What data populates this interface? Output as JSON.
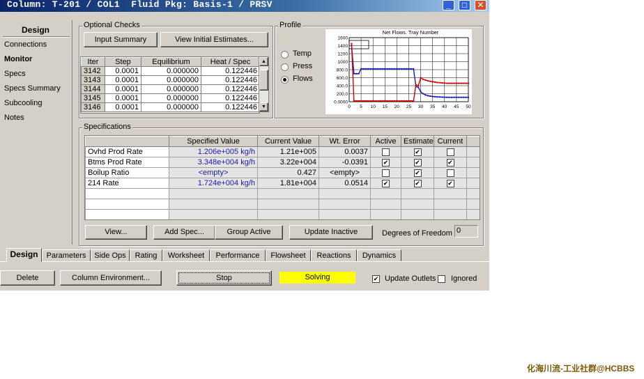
{
  "window": {
    "title": "Column: T-201 / COL1  Fluid Pkg: Basis-1 / PRSV",
    "controls": {
      "minimize": "_",
      "maximize": "□",
      "close": "✕"
    }
  },
  "nav": {
    "heading": "Design",
    "items": [
      "Connections",
      "Monitor",
      "Specs",
      "Specs Summary",
      "Subcooling",
      "Notes"
    ],
    "selected": "Monitor"
  },
  "optional_checks": {
    "label": "Optional Checks",
    "input_summary": "Input Summary",
    "view_initial": "View Initial Estimates..."
  },
  "iterations": {
    "columns": [
      "Iter",
      "Step",
      "Equilibrium",
      "Heat / Spec"
    ],
    "rows": [
      [
        "314­2",
        "0.0001",
        "0.000000",
        "0.122446"
      ],
      [
        "314­3",
        "0.0001",
        "0.000000",
        "0.122446"
      ],
      [
        "314­4",
        "0.0001",
        "0.000000",
        "0.122446"
      ],
      [
        "314­5",
        "0.0001",
        "0.000000",
        "0.122446"
      ],
      [
        "314­6",
        "0.0001",
        "0.000000",
        "0.122446"
      ]
    ],
    "row_labels": [
      "3142",
      "3143",
      "3144",
      "3145",
      "3146"
    ]
  },
  "profile": {
    "label": "Profile",
    "options": [
      "Temp",
      "Press",
      "Flows"
    ],
    "selected": "Flows"
  },
  "chart_data": {
    "type": "line",
    "title": "Net Flows. Tray Number",
    "x_ticks": [
      "0",
      "5",
      "10",
      "15",
      "20",
      "25",
      "30",
      "35",
      "40",
      "45",
      "50"
    ],
    "y_ticks": [
      "0.0000",
      "200.0",
      "400.0",
      "600.0",
      "800.0",
      "1000",
      "1200",
      "1400",
      "1600"
    ],
    "xlim": [
      0,
      50
    ],
    "ylim": [
      0,
      1600
    ],
    "series": [
      {
        "color": "#1a1ab4",
        "x": [
          1,
          2,
          3,
          4,
          5,
          6,
          7,
          8,
          9,
          10,
          11,
          12,
          13,
          14,
          15,
          16,
          17,
          18,
          19,
          20,
          21,
          22,
          23,
          24,
          25,
          26,
          27,
          28,
          29,
          30,
          31,
          32,
          33,
          34,
          35,
          36,
          37,
          38,
          39,
          40,
          41,
          42,
          43,
          44,
          45,
          46,
          47,
          48,
          49,
          50
        ],
        "y": [
          1400,
          700,
          700,
          700,
          820,
          820,
          820,
          820,
          820,
          820,
          820,
          820,
          820,
          820,
          820,
          820,
          820,
          820,
          820,
          820,
          820,
          820,
          820,
          820,
          820,
          820,
          820,
          380,
          360,
          250,
          200,
          170,
          150,
          140,
          130,
          125,
          120,
          118,
          115,
          112,
          110,
          110,
          110,
          110,
          110,
          110,
          110,
          110,
          110,
          110
        ]
      },
      {
        "color": "#d40000",
        "x": [
          1,
          2,
          3,
          4,
          5,
          6,
          7,
          8,
          9,
          10,
          11,
          12,
          13,
          14,
          15,
          16,
          17,
          18,
          19,
          20,
          21,
          22,
          23,
          24,
          25,
          26,
          27,
          28,
          29,
          30,
          31,
          32,
          33,
          34,
          35,
          36,
          37,
          38,
          39,
          40,
          41,
          42,
          43,
          44,
          45,
          46,
          47,
          48,
          49,
          50
        ],
        "y": [
          1450,
          20,
          20,
          20,
          20,
          20,
          20,
          20,
          20,
          20,
          20,
          20,
          20,
          20,
          20,
          20,
          20,
          20,
          20,
          20,
          20,
          20,
          20,
          20,
          20,
          20,
          20,
          420,
          400,
          600,
          560,
          540,
          520,
          510,
          500,
          490,
          480,
          475,
          470,
          465,
          460,
          460,
          460,
          460,
          460,
          460,
          460,
          460,
          460,
          460
        ]
      }
    ]
  },
  "specs": {
    "label": "Specifications",
    "columns": [
      "",
      "Specified Value",
      "Current Value",
      "Wt. Error",
      "Active",
      "Estimate",
      "Current"
    ],
    "rows": [
      {
        "name": "Ovhd Prod Rate",
        "specified": "1.206e+005 kg/h",
        "current": "1.21e+005",
        "error": "0.0037",
        "active": false,
        "estimate": true,
        "curr": false
      },
      {
        "name": "Btms Prod Rate",
        "specified": "3.348e+004 kg/h",
        "current": "3.22e+004",
        "error": "-0.0391",
        "active": true,
        "estimate": true,
        "curr": true
      },
      {
        "name": "Boilup Ratio",
        "specified": "<empty>",
        "current": "0.427",
        "error": "<empty>",
        "active": false,
        "estimate": true,
        "curr": false
      },
      {
        "name": "214 Rate",
        "specified": "1.724e+004 kg/h",
        "current": "1.81e+004",
        "error": "0.0514",
        "active": true,
        "estimate": true,
        "curr": true
      }
    ]
  },
  "spec_buttons": {
    "view": "View...",
    "add_spec": "Add Spec...",
    "group_active": "Group Active",
    "update_inactive": "Update Inactive",
    "dof_label": "Degrees of Freedom",
    "dof_value": "0"
  },
  "tabs": [
    "Design",
    "Parameters",
    "Side Ops",
    "Rating",
    "Worksheet",
    "Performance",
    "Flowsheet",
    "Reactions",
    "Dynamics"
  ],
  "bottom": {
    "delete": "Delete",
    "column_env": "Column Environment...",
    "stop": "Stop",
    "status": "Solving",
    "status_color": "#ffff00",
    "update_outlets": "Update Outlets",
    "update_outlets_checked": true,
    "ignored": "Ignored",
    "ignored_checked": false
  },
  "watermark": "化海川流-工业社群@HCBBS"
}
